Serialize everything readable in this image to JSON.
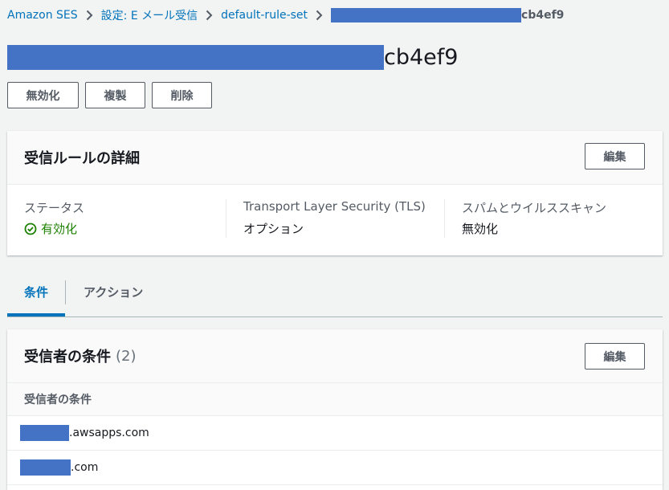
{
  "breadcrumb": {
    "items": [
      "Amazon SES",
      "設定: E メール受信",
      "default-rule-set"
    ],
    "current_suffix": "cb4ef9"
  },
  "page": {
    "title_suffix": "cb4ef9"
  },
  "actions": {
    "disable": "無効化",
    "copy": "複製",
    "delete": "削除"
  },
  "details": {
    "title": "受信ルールの詳細",
    "edit_label": "編集",
    "status_label": "ステータス",
    "status_value": "有効化",
    "tls_label": "Transport Layer Security (TLS)",
    "tls_value": "オプション",
    "spam_label": "スパムとウイルススキャン",
    "spam_value": "無効化"
  },
  "tabs": {
    "conditions": "条件",
    "actions": "アクション"
  },
  "conditions": {
    "title": "受信者の条件",
    "count": "(2)",
    "edit_label": "編集",
    "column_header": "受信者の条件",
    "rows": [
      {
        "suffix": ".awsapps.com"
      },
      {
        "suffix": ".com"
      }
    ]
  },
  "colors": {
    "link": "#0073bb",
    "success": "#1d8102",
    "redaction": "#4472c4"
  }
}
